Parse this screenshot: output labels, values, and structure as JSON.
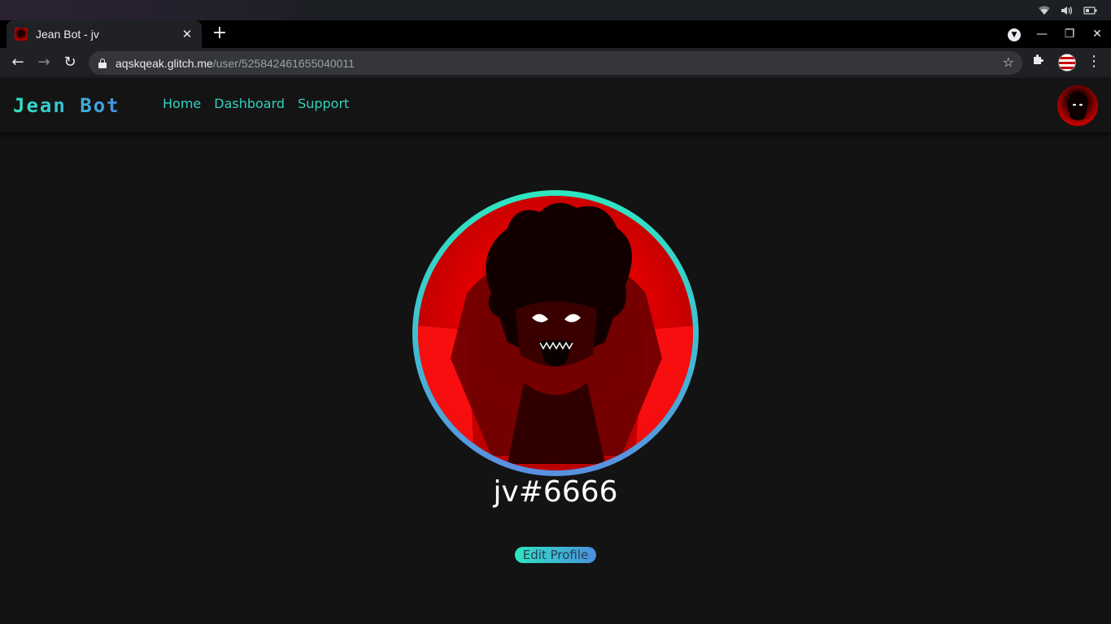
{
  "browser": {
    "tab": {
      "title": "Jean Bot - jv",
      "favicon": "avatar-favicon-icon"
    },
    "url": {
      "host": "aqskqeak.glitch.me",
      "path": "/user/525842461655040011"
    }
  },
  "site": {
    "brand": "Jean Bot",
    "nav": [
      {
        "label": "Home"
      },
      {
        "label": "Dashboard"
      },
      {
        "label": "Support"
      }
    ]
  },
  "profile": {
    "username": "jv#6666",
    "edit_button": "Edit Profile"
  },
  "colors": {
    "accent_start": "#2ee6c0",
    "accent_end": "#4a8fe0",
    "page_bg": "#131313",
    "avatar_red": "#d40000"
  }
}
